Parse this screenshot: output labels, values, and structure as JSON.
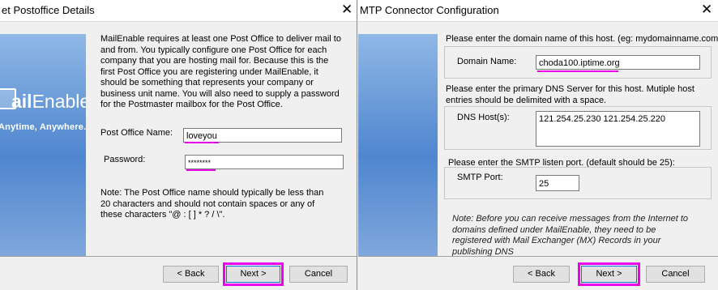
{
  "left": {
    "title": "et Postoffice Details",
    "close_symbol": "✕",
    "logo_bold": "ail",
    "logo_rest": "Enable",
    "tagline": "Anytime, Anywhere.",
    "intro": "MailEnable requires at least one Post Office to deliver mail to and from. You typically configure one Post Office for each company that you are hosting mail for. Because this is the first Post Office you are registering under MailEnable, it should be something that represents your company or business unit name. You will also need to supply a password for the Postmaster mailbox for the Post Office.",
    "postoffice_label": "Post Office Name:",
    "postoffice_value": "loveyou",
    "password_label": "Password:",
    "password_value": "********",
    "note": "Note: The Post Office name should typically be less than 20 characters and should not contain spaces or any of these characters \"@ : [ ] * ? / \\\".",
    "back_label": "< Back",
    "next_label": "Next >",
    "cancel_label": "Cancel"
  },
  "right": {
    "title": "MTP Connector Configuration",
    "close_symbol": "✕",
    "domain_prompt": "Please enter the domain name of this host. (eg: mydomainname.com).",
    "domain_label": "Domain Name:",
    "domain_value": "choda100.iptime.org",
    "dns_prompt": "Please enter the primary DNS Server for this host. Mutiple host entries should be delimited with a space.",
    "dns_label": "DNS Host(s):",
    "dns_value": "121.254.25.230 121.254.25.220",
    "smtp_prompt": "Please enter the SMTP listen port. (default should be 25):",
    "smtp_label": "SMTP Port:",
    "smtp_value": "25",
    "note": "Note: Before you can receive messages from the Internet to domains defined under MailEnable, they need to be registered with Mail Exchanger (MX) Records in your publishing DNS",
    "back_label": "< Back",
    "next_label": "Next >",
    "cancel_label": "Cancel"
  },
  "colors": {
    "highlight": "#ee00ee",
    "banner": "#4f86cf"
  }
}
